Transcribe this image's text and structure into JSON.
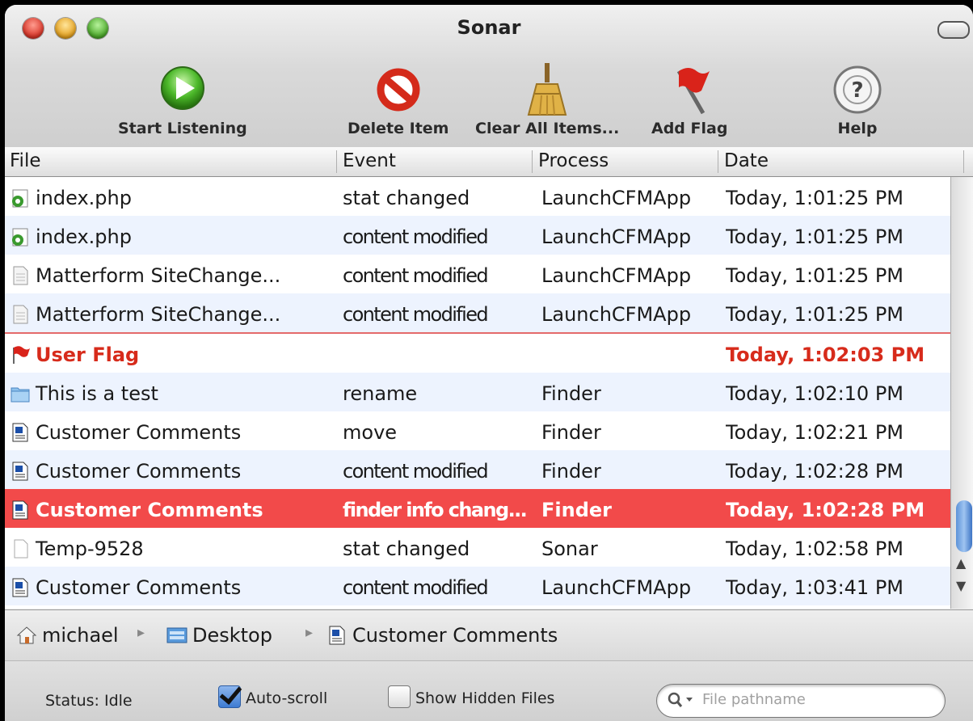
{
  "window": {
    "title": "Sonar"
  },
  "toolbar": {
    "start_listening": "Start Listening",
    "delete_item": "Delete Item",
    "clear_all_items": "Clear All Items...",
    "add_flag": "Add Flag",
    "help": "Help"
  },
  "table": {
    "columns": [
      "File",
      "Event",
      "Process",
      "Date"
    ],
    "rows": [
      {
        "icon": "php-file-icon",
        "file": "index.php",
        "event": "stat changed",
        "process": "LaunchCFMApp",
        "date": "Today, 1:01:25 PM"
      },
      {
        "icon": "php-file-icon",
        "file": "index.php",
        "event": "content modified",
        "process": "LaunchCFMApp",
        "date": "Today, 1:01:25 PM"
      },
      {
        "icon": "document-icon",
        "file": "Matterform SiteChange...",
        "event": "content modified",
        "process": "LaunchCFMApp",
        "date": "Today, 1:01:25 PM"
      },
      {
        "icon": "document-icon",
        "file": "Matterform SiteChange...",
        "event": "content modified",
        "process": "LaunchCFMApp",
        "date": "Today, 1:01:25 PM"
      },
      {
        "icon": "flag-icon",
        "file": "User Flag",
        "event": "",
        "process": "",
        "date": "Today, 1:02:03 PM",
        "type": "flag"
      },
      {
        "icon": "folder-icon",
        "file": "This is a test",
        "event": "rename",
        "process": "Finder",
        "date": "Today, 1:02:10 PM"
      },
      {
        "icon": "text-document-icon",
        "file": "Customer Comments",
        "event": "move",
        "process": "Finder",
        "date": "Today, 1:02:21 PM"
      },
      {
        "icon": "text-document-icon",
        "file": "Customer Comments",
        "event": "content modified",
        "process": "Finder",
        "date": "Today, 1:02:28 PM"
      },
      {
        "icon": "text-document-icon",
        "file": "Customer Comments",
        "event": "finder info chang...",
        "process": "Finder",
        "date": "Today, 1:02:28 PM",
        "type": "selected"
      },
      {
        "icon": "blank-document-icon",
        "file": "Temp-9528",
        "event": "stat changed",
        "process": "Sonar",
        "date": "Today, 1:02:58 PM"
      },
      {
        "icon": "text-document-icon",
        "file": "Customer Comments",
        "event": "content modified",
        "process": "LaunchCFMApp",
        "date": "Today, 1:03:41 PM"
      }
    ]
  },
  "pathbar": {
    "items": [
      "michael",
      "Desktop",
      "Customer Comments"
    ]
  },
  "statusbar": {
    "status": "Status: Idle",
    "auto_scroll_label": "Auto-scroll",
    "auto_scroll_checked": true,
    "show_hidden_label": "Show Hidden Files",
    "show_hidden_checked": false,
    "search_placeholder": "File pathname"
  },
  "colors": {
    "selection": "#f24a4a",
    "flag_text": "#d72b1b",
    "alt_row": "#edf3fe"
  }
}
